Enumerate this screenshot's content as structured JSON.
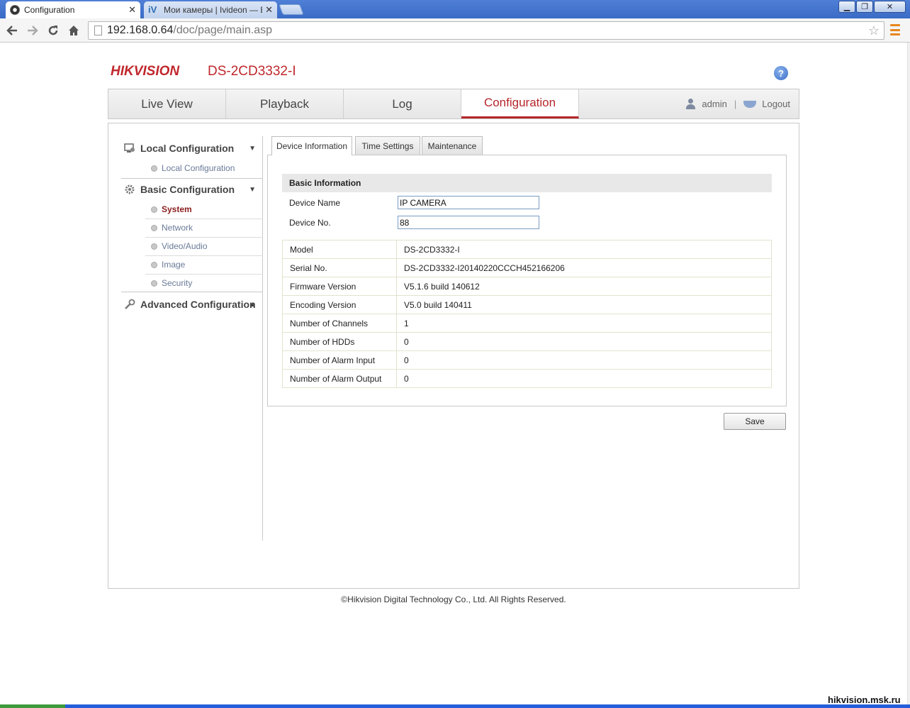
{
  "browser": {
    "tabs": [
      {
        "label": "Configuration",
        "close": "✕"
      },
      {
        "label": "Мои камеры | Ivideon — Ви",
        "close": "✕",
        "favicon_text": "iV"
      }
    ],
    "window_controls": {
      "minimize": "▁",
      "maximize": "❐",
      "close": "✕"
    },
    "url_host": "192.168.0.64",
    "url_path": "/doc/page/main.asp",
    "icons": [
      "back-icon",
      "forward-icon",
      "reload-icon",
      "home-icon",
      "bookmark-star-icon",
      "menu-icon"
    ]
  },
  "header": {
    "logo": "HIKVISION",
    "model": "DS-2CD3332-I",
    "help": "?"
  },
  "nav": {
    "items": [
      "Live View",
      "Playback",
      "Log",
      "Configuration"
    ],
    "active": "Configuration",
    "user": "admin",
    "separator": "|",
    "logout": "Logout"
  },
  "sidebar": {
    "local_group": "Local Configuration",
    "local_items": [
      "Local Configuration"
    ],
    "basic_group": "Basic Configuration",
    "basic_items": [
      "System",
      "Network",
      "Video/Audio",
      "Image",
      "Security"
    ],
    "active_item": "System",
    "advanced_group": "Advanced Configuration"
  },
  "tabs": [
    "Device Information",
    "Time Settings",
    "Maintenance"
  ],
  "basic_info": {
    "heading": "Basic Information",
    "device_name_label": "Device Name",
    "device_name_value": "IP CAMERA",
    "device_no_label": "Device No.",
    "device_no_value": "88"
  },
  "info_rows": [
    {
      "label": "Model",
      "value": "DS-2CD3332-I"
    },
    {
      "label": "Serial No.",
      "value": "DS-2CD3332-I20140220CCCH452166206"
    },
    {
      "label": "Firmware Version",
      "value": "V5.1.6 build 140612"
    },
    {
      "label": "Encoding Version",
      "value": "V5.0 build 140411"
    },
    {
      "label": "Number of Channels",
      "value": "1"
    },
    {
      "label": "Number of HDDs",
      "value": "0"
    },
    {
      "label": "Number of Alarm Input",
      "value": "0"
    },
    {
      "label": "Number of Alarm Output",
      "value": "0"
    }
  ],
  "save_label": "Save",
  "footer": "©Hikvision Digital Technology Co., Ltd. All Rights Reserved.",
  "watermark": "hikvision.msk.ru",
  "colors": {
    "brand": "#c0272d",
    "active_nav": "#b6262b"
  }
}
